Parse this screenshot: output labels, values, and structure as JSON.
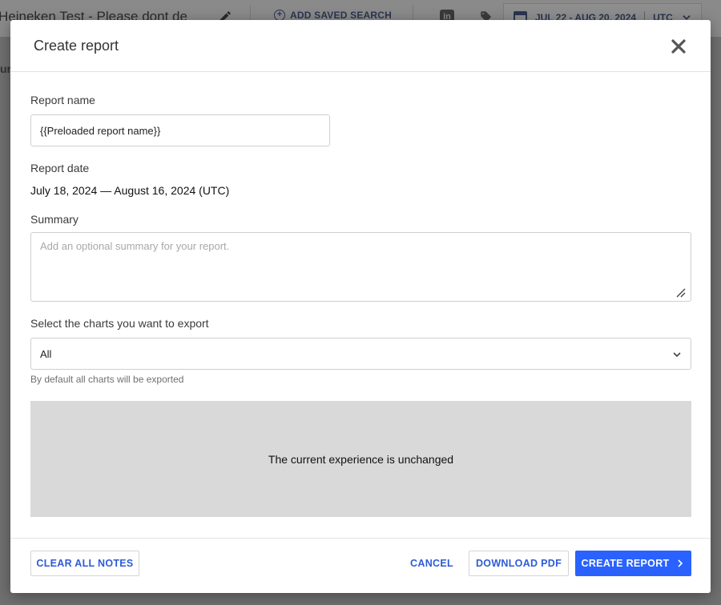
{
  "background": {
    "title": "Heineken Test - Please dont de",
    "saved_search_label": "ADD SAVED SEARCH",
    "linkedin_label": "in",
    "date_range": "JUL 22 - AUG 20, 2024",
    "timezone": "UTC",
    "left_text": "ur"
  },
  "modal": {
    "title": "Create report",
    "report_name_label": "Report name",
    "report_name_value": "{{Preloaded report name}}",
    "report_date_label": "Report date",
    "report_date_value": "July 18, 2024 — August 16, 2024 (UTC)",
    "summary_label": "Summary",
    "summary_placeholder": "Add an optional summary for your report.",
    "charts_label": "Select the charts you want to export",
    "charts_selected": "All",
    "charts_helper": "By default all charts will be exported",
    "placeholder_text": "The current experience is unchanged"
  },
  "footer": {
    "clear_notes": "CLEAR ALL NOTES",
    "cancel": "CANCEL",
    "download_pdf": "DOWNLOAD PDF",
    "create_report": "CREATE REPORT"
  },
  "colors": {
    "accent": "#2962ff",
    "accent_text": "#2e5bd6",
    "overlay": "#707070"
  }
}
